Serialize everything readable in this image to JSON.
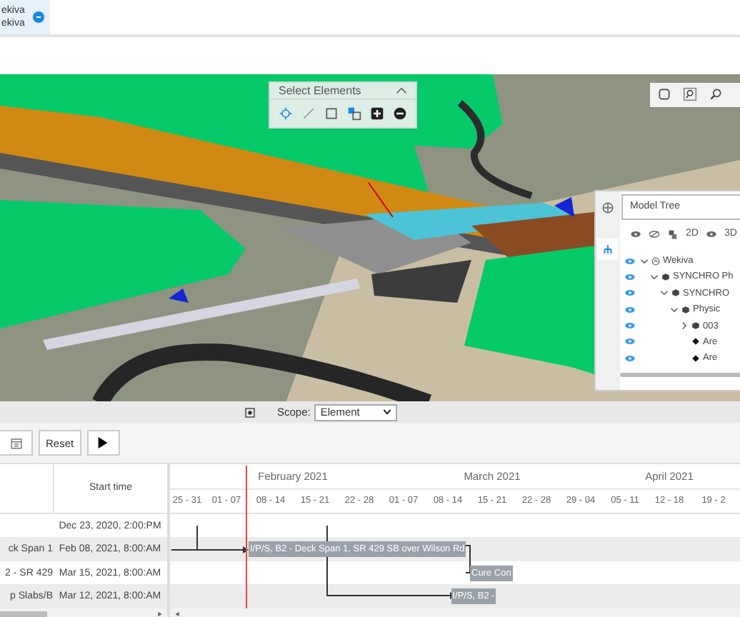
{
  "document_tab": {
    "lines": [
      "ekiva",
      "ekiva"
    ],
    "selected": true
  },
  "select_panel": {
    "title": "Select Elements",
    "expanded": true
  },
  "model_tree": {
    "title": "Model Tree",
    "toolbar_labels": [
      "2D",
      "3D"
    ],
    "tree": [
      {
        "label": "Wekiva",
        "expanded": true,
        "children": [
          {
            "label": "SYNCHRO Ph",
            "expanded": true,
            "children": [
              {
                "label": "SYNCHRO",
                "expanded": true,
                "children": [
                  {
                    "label": "Physic",
                    "expanded": true,
                    "children": [
                      {
                        "label": "003",
                        "expanded": false
                      },
                      {
                        "label": "Are"
                      },
                      {
                        "label": "Are"
                      }
                    ]
                  }
                ]
              }
            ]
          }
        ]
      }
    ]
  },
  "scope": {
    "label": "Scope:",
    "value": "Element"
  },
  "toolbar": {
    "reset": "Reset"
  },
  "schedule": {
    "columns": [
      "Start time"
    ],
    "months": [
      {
        "weeks": [
          "25 - 31"
        ]
      },
      {
        "label": "February 2021",
        "weeks": [
          "01 - 07",
          "08 - 14",
          "15 - 21",
          "22 - 28"
        ]
      },
      {
        "label": "March 2021",
        "weeks": [
          "01 - 07",
          "08 - 14",
          "15 - 21",
          "22 - 28",
          "29 - 04"
        ]
      },
      {
        "label": "April 2021",
        "weeks": [
          "05 - 11",
          "12 - 18",
          "19 - 2"
        ]
      }
    ],
    "rows": [
      {
        "start": "Dec 23, 2020, 2:00:PM"
      },
      {
        "name": "ck Span 1",
        "start": "Feb 08, 2021, 8:00:AM",
        "bar": "I/P/S, B2 - Deck Span 1, SR 429 SB over Wilson Rd"
      },
      {
        "name": "2 - SR 429",
        "start": "Mar 15, 2021, 8:00:AM",
        "bar": "Cure Con"
      },
      {
        "name": "p Slabs/B",
        "start": "Mar 12, 2021, 8:00:AM",
        "bar": "I/P/S, B2 -"
      }
    ]
  }
}
